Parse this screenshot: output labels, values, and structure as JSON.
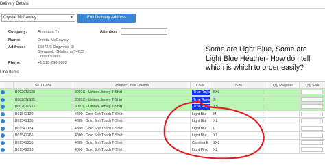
{
  "delivery": {
    "title": "Delivery Details",
    "customer_select": "Crystal McCawley",
    "edit_button": "Edit Delivery Address",
    "labels": {
      "company": "Company:",
      "name": "Name:",
      "address": "Address:",
      "phone": "Phone:",
      "attention": "Attention"
    },
    "company": "American Tx",
    "name": "Crystal McCawley",
    "address": "15072 S Dogwood St\nGlenpool, Oklahoma 74033\nUnited States",
    "phone": "+1 918-298-6682"
  },
  "annotation": "Some are Light Blue, Some are Light Blue Heather- How do I tell which is which to order easily?",
  "line_items": {
    "title": "Line Items",
    "columns": [
      "SKU Code",
      "Product Code - Name",
      "Color",
      "Size",
      "Qty Required",
      "Qty Sele"
    ],
    "rows": [
      {
        "sku": "B002CNS30",
        "product": "3001C - Unisex Jersey T-Shirt",
        "color": "True Roya",
        "size": "5XL",
        "checked": true,
        "highlight": true
      },
      {
        "sku": "B002CNS35",
        "product": "3001C - Unisex Jersey T-Shirt",
        "color": "True Roya",
        "size": "S",
        "checked": true,
        "highlight": true
      },
      {
        "sku": "B002CNS33",
        "product": "3001C - Unisex Jersey T-Shirt",
        "color": "True Roya",
        "size": "XS",
        "checked": true,
        "highlight": true
      },
      {
        "sku": "B01542130",
        "product": "4800 - Gold Soft Touch T-Shirt",
        "color": "Light Blu",
        "size": "M",
        "checked": false,
        "highlight": false
      },
      {
        "sku": "B01542136",
        "product": "4800 - Gold Soft Touch T-Shirt",
        "color": "Light Blu",
        "size": "XL",
        "checked": false,
        "highlight": false
      },
      {
        "sku": "B01542134",
        "product": "4800 - Gold Soft Touch T-Shirt",
        "color": "Light Blu",
        "size": "L",
        "checked": false,
        "highlight": false
      },
      {
        "sku": "B01542266",
        "product": "4800 - Gold Soft Touch T-Shirt",
        "color": "Light Blu",
        "size": "XL",
        "checked": false,
        "highlight": false
      },
      {
        "sku": "B01542256",
        "product": "4800 - Gold Soft Touch T-Shirt",
        "color": "Carolina E",
        "size": "2XL",
        "checked": false,
        "highlight": false
      },
      {
        "sku": "B01542210",
        "product": "4800 - Gold Soft Touch T-Shirt",
        "color": "Light Pink",
        "size": "XL",
        "checked": false,
        "highlight": false
      }
    ]
  },
  "colors": {
    "accent": "#3a87d6",
    "highlight_row": "#b9f5b3",
    "true_royal": "#1433ff",
    "annotation_circle": "#e02020"
  }
}
